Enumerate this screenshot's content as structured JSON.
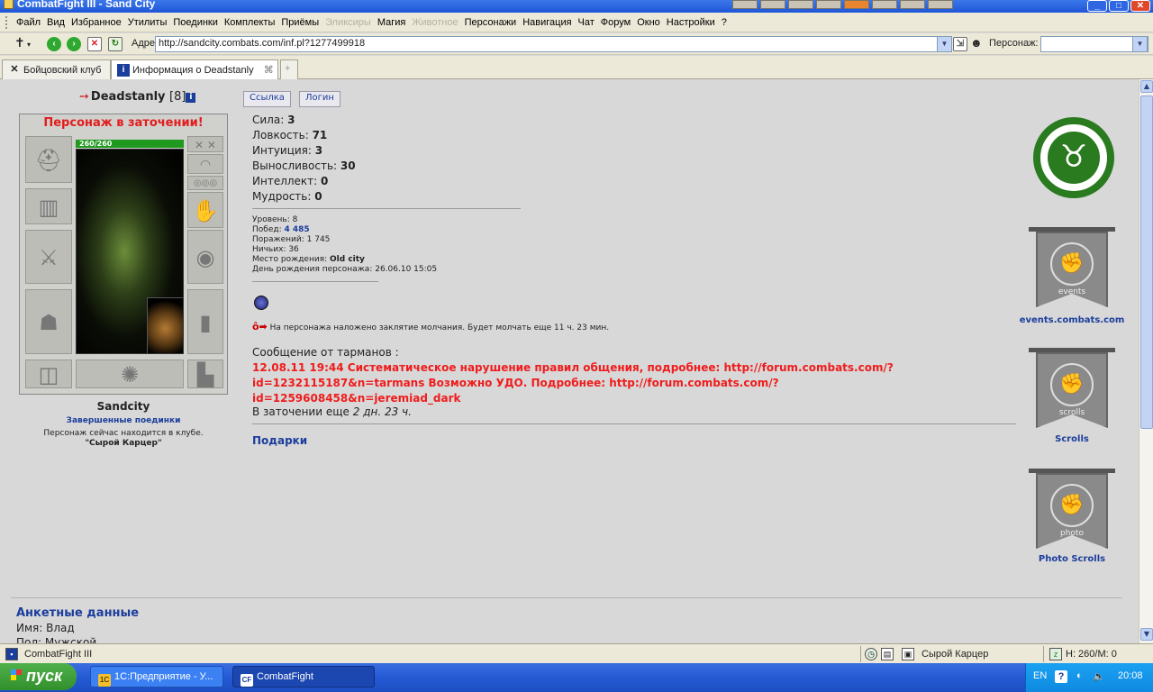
{
  "window": {
    "title": "CombatFight III - Sand City"
  },
  "menu": [
    "Файл",
    "Вид",
    "Избранное",
    "Утилиты",
    "Поединки",
    "Комплекты",
    "Приёмы",
    "Эликсиры",
    "Магия",
    "Животное",
    "Персонажи",
    "Навигация",
    "Чат",
    "Форум",
    "Окно",
    "Настройки",
    "?"
  ],
  "menu_disabled": [
    "Эликсиры",
    "Животное"
  ],
  "address": {
    "label": "Адрес:",
    "url": "http://sandcity.combats.com/inf.pl?1277499918",
    "person_label": "Персонаж:",
    "person_value": ""
  },
  "tabs": [
    {
      "label": "Бойцовский клуб"
    },
    {
      "label": "Информация о Deadstanly"
    }
  ],
  "character": {
    "name": "Deadstanly",
    "level": "[8]",
    "jail_title": "Персонаж в заточении!",
    "hp": "260/260",
    "city": "Sandcity",
    "finished_fights": "Завершенные поединки",
    "location_line": "Персонаж сейчас находится в клубе.",
    "location": "\"Сырой Карцер\""
  },
  "buttons": {
    "link": "Ссылка",
    "login": "Логин"
  },
  "stats": [
    {
      "label": "Сила:",
      "value": "3"
    },
    {
      "label": "Ловкость:",
      "value": "71"
    },
    {
      "label": "Интуиция:",
      "value": "3"
    },
    {
      "label": "Выносливость:",
      "value": "30"
    },
    {
      "label": "Интеллект:",
      "value": "0"
    },
    {
      "label": "Мудрость:",
      "value": "0"
    }
  ],
  "info": {
    "level_label": "Уровень:",
    "level_value": "8",
    "wins_label": "Побед:",
    "wins_value": "4 485",
    "losses_label": "Поражений:",
    "losses_value": "1 745",
    "draws_label": "Ничьих:",
    "draws_value": "36",
    "birthplace_label": "Место рождения:",
    "birthplace_value": "Old city",
    "birthday_label": "День рождения персонажа:",
    "birthday_value": "26.06.10 15:05"
  },
  "silence_text": "На персонажа наложено заклятие молчания. Будет молчать еще 11 ч. 23 мин.",
  "message": {
    "head": "Сообщение от тарманов :",
    "lines": [
      "12.08.11 19:44 Систематическое нарушение правил общения, подробнее: http://forum.combats.com/?",
      "id=1232115187&n=tarmans Возможно УДО. Подробнее: http://forum.combats.com/?",
      "id=1259608458&n=jeremiad_dark"
    ],
    "jail_prefix": "В заточении еще",
    "jail_time": "2 дн. 23 ч."
  },
  "gifts_label": "Подарки",
  "sidebar_links": [
    {
      "label": "events.combats.com",
      "banner_text": "events"
    },
    {
      "label": "Scrolls",
      "banner_text": "scrolls"
    },
    {
      "label": "Photo Scrolls",
      "banner_text": "photo"
    }
  ],
  "anket": {
    "title": "Анкетные данные",
    "name_line": "Имя: Влад",
    "gender_line": "Пол: Мужской"
  },
  "status": {
    "app": "CombatFight III",
    "location": "Сырой Карцер",
    "hpm": "H: 260/M: 0"
  },
  "taskbar": {
    "start": "пуск",
    "tasks": [
      "1С:Предприятие - У...",
      "CombatFight"
    ],
    "lang": "EN",
    "clock": "20:08"
  },
  "colors": {
    "jail_red": "#e21d1d",
    "link_blue": "#1b3d9c",
    "hp_green": "#1f9a1f",
    "emblem_green": "#2a7a1f"
  }
}
